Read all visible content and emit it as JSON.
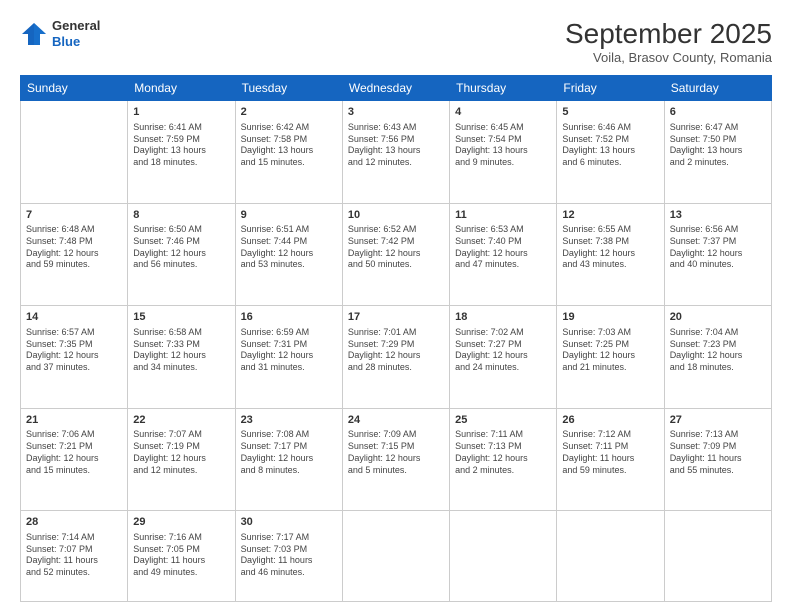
{
  "header": {
    "logo_line1": "General",
    "logo_line2": "Blue",
    "month_title": "September 2025",
    "subtitle": "Voila, Brasov County, Romania"
  },
  "days_of_week": [
    "Sunday",
    "Monday",
    "Tuesday",
    "Wednesday",
    "Thursday",
    "Friday",
    "Saturday"
  ],
  "weeks": [
    [
      {
        "num": "",
        "info": ""
      },
      {
        "num": "1",
        "info": "Sunrise: 6:41 AM\nSunset: 7:59 PM\nDaylight: 13 hours\nand 18 minutes."
      },
      {
        "num": "2",
        "info": "Sunrise: 6:42 AM\nSunset: 7:58 PM\nDaylight: 13 hours\nand 15 minutes."
      },
      {
        "num": "3",
        "info": "Sunrise: 6:43 AM\nSunset: 7:56 PM\nDaylight: 13 hours\nand 12 minutes."
      },
      {
        "num": "4",
        "info": "Sunrise: 6:45 AM\nSunset: 7:54 PM\nDaylight: 13 hours\nand 9 minutes."
      },
      {
        "num": "5",
        "info": "Sunrise: 6:46 AM\nSunset: 7:52 PM\nDaylight: 13 hours\nand 6 minutes."
      },
      {
        "num": "6",
        "info": "Sunrise: 6:47 AM\nSunset: 7:50 PM\nDaylight: 13 hours\nand 2 minutes."
      }
    ],
    [
      {
        "num": "7",
        "info": "Sunrise: 6:48 AM\nSunset: 7:48 PM\nDaylight: 12 hours\nand 59 minutes."
      },
      {
        "num": "8",
        "info": "Sunrise: 6:50 AM\nSunset: 7:46 PM\nDaylight: 12 hours\nand 56 minutes."
      },
      {
        "num": "9",
        "info": "Sunrise: 6:51 AM\nSunset: 7:44 PM\nDaylight: 12 hours\nand 53 minutes."
      },
      {
        "num": "10",
        "info": "Sunrise: 6:52 AM\nSunset: 7:42 PM\nDaylight: 12 hours\nand 50 minutes."
      },
      {
        "num": "11",
        "info": "Sunrise: 6:53 AM\nSunset: 7:40 PM\nDaylight: 12 hours\nand 47 minutes."
      },
      {
        "num": "12",
        "info": "Sunrise: 6:55 AM\nSunset: 7:38 PM\nDaylight: 12 hours\nand 43 minutes."
      },
      {
        "num": "13",
        "info": "Sunrise: 6:56 AM\nSunset: 7:37 PM\nDaylight: 12 hours\nand 40 minutes."
      }
    ],
    [
      {
        "num": "14",
        "info": "Sunrise: 6:57 AM\nSunset: 7:35 PM\nDaylight: 12 hours\nand 37 minutes."
      },
      {
        "num": "15",
        "info": "Sunrise: 6:58 AM\nSunset: 7:33 PM\nDaylight: 12 hours\nand 34 minutes."
      },
      {
        "num": "16",
        "info": "Sunrise: 6:59 AM\nSunset: 7:31 PM\nDaylight: 12 hours\nand 31 minutes."
      },
      {
        "num": "17",
        "info": "Sunrise: 7:01 AM\nSunset: 7:29 PM\nDaylight: 12 hours\nand 28 minutes."
      },
      {
        "num": "18",
        "info": "Sunrise: 7:02 AM\nSunset: 7:27 PM\nDaylight: 12 hours\nand 24 minutes."
      },
      {
        "num": "19",
        "info": "Sunrise: 7:03 AM\nSunset: 7:25 PM\nDaylight: 12 hours\nand 21 minutes."
      },
      {
        "num": "20",
        "info": "Sunrise: 7:04 AM\nSunset: 7:23 PM\nDaylight: 12 hours\nand 18 minutes."
      }
    ],
    [
      {
        "num": "21",
        "info": "Sunrise: 7:06 AM\nSunset: 7:21 PM\nDaylight: 12 hours\nand 15 minutes."
      },
      {
        "num": "22",
        "info": "Sunrise: 7:07 AM\nSunset: 7:19 PM\nDaylight: 12 hours\nand 12 minutes."
      },
      {
        "num": "23",
        "info": "Sunrise: 7:08 AM\nSunset: 7:17 PM\nDaylight: 12 hours\nand 8 minutes."
      },
      {
        "num": "24",
        "info": "Sunrise: 7:09 AM\nSunset: 7:15 PM\nDaylight: 12 hours\nand 5 minutes."
      },
      {
        "num": "25",
        "info": "Sunrise: 7:11 AM\nSunset: 7:13 PM\nDaylight: 12 hours\nand 2 minutes."
      },
      {
        "num": "26",
        "info": "Sunrise: 7:12 AM\nSunset: 7:11 PM\nDaylight: 11 hours\nand 59 minutes."
      },
      {
        "num": "27",
        "info": "Sunrise: 7:13 AM\nSunset: 7:09 PM\nDaylight: 11 hours\nand 55 minutes."
      }
    ],
    [
      {
        "num": "28",
        "info": "Sunrise: 7:14 AM\nSunset: 7:07 PM\nDaylight: 11 hours\nand 52 minutes."
      },
      {
        "num": "29",
        "info": "Sunrise: 7:16 AM\nSunset: 7:05 PM\nDaylight: 11 hours\nand 49 minutes."
      },
      {
        "num": "30",
        "info": "Sunrise: 7:17 AM\nSunset: 7:03 PM\nDaylight: 11 hours\nand 46 minutes."
      },
      {
        "num": "",
        "info": ""
      },
      {
        "num": "",
        "info": ""
      },
      {
        "num": "",
        "info": ""
      },
      {
        "num": "",
        "info": ""
      }
    ]
  ]
}
